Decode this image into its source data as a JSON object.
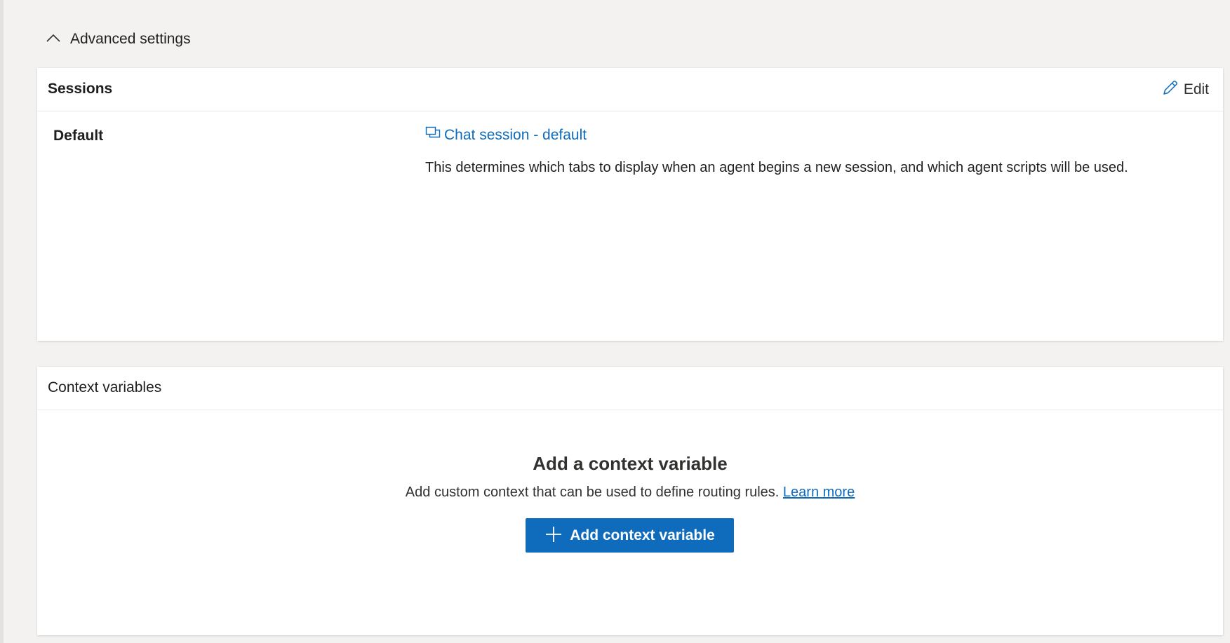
{
  "advanced": {
    "title": "Advanced settings"
  },
  "sessions": {
    "title": "Sessions",
    "edit_label": "Edit",
    "default_label": "Default",
    "session_link": "Chat session - default",
    "description": "This determines which tabs to display when an agent begins a new session, and which agent scripts will be used."
  },
  "context": {
    "title": "Context variables",
    "empty_title": "Add a context variable",
    "empty_desc": "Add custom context that can be used to define routing rules.",
    "learn_more": "Learn more",
    "add_button": "Add context variable"
  },
  "icons": {
    "collapse": "chevron-up-icon",
    "edit": "pencil-icon",
    "session": "chat-session-icon",
    "add": "plus-icon"
  },
  "colors": {
    "accent": "#0f6cbd",
    "background": "#f3f2f1"
  }
}
